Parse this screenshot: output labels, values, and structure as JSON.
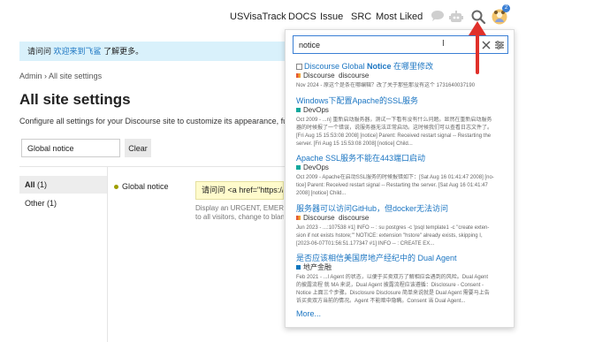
{
  "nav": {
    "items": [
      "USVisaTrack",
      "DOCS",
      "Issue",
      "SRC",
      "Most Liked"
    ],
    "icons": [
      "chat-icon",
      "robot-icon",
      "search-icon",
      "user-avatar"
    ],
    "badge_count": "2"
  },
  "banner": {
    "prefix": "请问问",
    "link": "欢迎来到飞鲨",
    "suffix": "了解更多。"
  },
  "breadcrumb": {
    "root": "Admin",
    "sep": "›",
    "current": "All site settings"
  },
  "page": {
    "title": "All site settings",
    "description": "Configure all settings for your Discourse site to customize its appearance, functio"
  },
  "filter": {
    "value": "Global notice",
    "clear_label": "Clear"
  },
  "categories": [
    {
      "label": "All",
      "count": "(1)"
    },
    {
      "label": "Other",
      "count": "(1)"
    }
  ],
  "setting": {
    "name": "Global notice",
    "value": "请问问 <a href=\"https://ww",
    "help_line1": "Display an URGENT, EMERGENC",
    "help_line2": "to all visitors, change to blank to"
  },
  "search": {
    "query": "notice",
    "results": [
      {
        "title_before": "Discourse Global ",
        "title_bold": "Notice",
        "title_after": " 在哪里修改",
        "category": "Discourse",
        "tag": "discourse",
        "category_color": "#e45735",
        "excerpt": [
          "Nov 2024 - 原这个是条在哪编辑？改了关于那些那没有这个 1731640037190"
        ]
      },
      {
        "title_before": "Windows下配置Apache的SSL服务",
        "title_bold": "",
        "title_after": "",
        "category": "DevOps",
        "tag": "",
        "category_color": "#12a89d",
        "excerpt": [
          "Oct 2009 - ...n] 重新启动服务器，测试一下看有没有什么问题。显然在重新启动服务",
          "器的时候报了一个错误，说服务器无法正常启动。这时候我们可以查看日志文件了。",
          "[Fri Aug 15 15:53:08 2008] [notice] Parent: Received restart signal -- Restarting the",
          "server. [Fri Aug 15 15:53:08 2008] [notice] Child..."
        ]
      },
      {
        "title_before": "Apache SSL服务不能在443端口启动",
        "title_bold": "",
        "title_after": "",
        "category": "DevOps",
        "tag": "",
        "category_color": "#12a89d",
        "excerpt": [
          "Oct 2009 - Apache在启动SSL服务的时候报错如下：[Sat Aug 16 01:41:47 2008] [no-",
          "tice] Parent: Received restart signal -- Restarting the server. [Sat Aug 16 01:41:47",
          "2008] [notice] Child..."
        ]
      },
      {
        "title_before": "服务器可以访问GitHub，但docker无法访问",
        "title_bold": "",
        "title_after": "",
        "category": "Discourse",
        "tag": "discourse",
        "category_color": "#e45735",
        "excerpt": [
          "Jun 2023 - ...:107538 #1] INFO -- : su postgres -c 'psql template1 -c \"create exten-",
          "sion if not exists hstore;\"' NOTICE: extension \"hstore\" already exists, skipping I,",
          "[2023-06-07T01:56:51.177347 #1] INFO -- : CREATE EX..."
        ]
      },
      {
        "title_before": "是否应该相信美国房地产经纪中的 Dual Agent",
        "title_bold": "",
        "title_after": "",
        "category": "地产金融",
        "tag": "",
        "category_color": "#0e76bd",
        "excerpt": [
          "Feb 2021 - ...l Agent 的状态，以便于买卖双方了解相应会遇到的风险。Dual Agent",
          "的披露流程 就 MA 来说，Dual Agent 披露流程应该遵循：Disclosure - Consent -",
          "Notice 上面三个步骤。Disclosure Disclosure 简单来说就是 Dual Agent 需要马上告",
          "诉买卖双方当前的情况。Agent 不能暗中隐瞒。Consent 当 Dual Agent..."
        ]
      }
    ],
    "more_label": "More..."
  },
  "colors": {
    "accent": "#3a7fd4",
    "link": "#1b75c2",
    "arrow": "#e0302a",
    "banner_bg": "#d9f1fb"
  }
}
